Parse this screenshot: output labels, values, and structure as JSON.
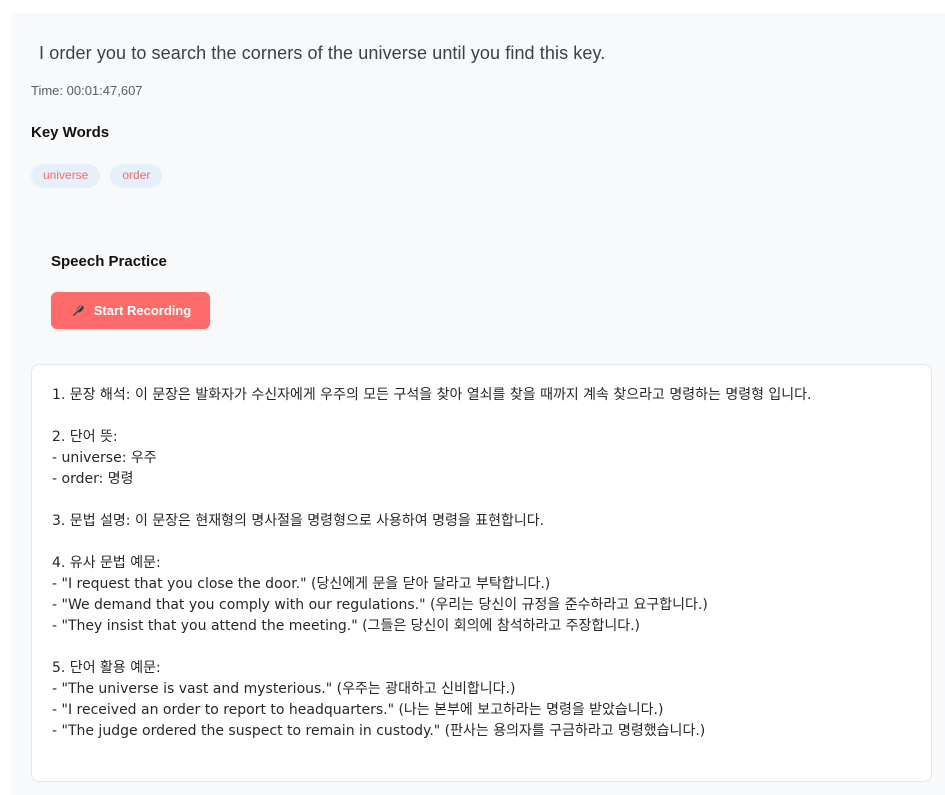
{
  "sentence": "I order you to search the corners of the universe until you find this key.",
  "time_text": "Time: 00:01:47,607",
  "keywords": {
    "title": "Key Words",
    "items": [
      "universe",
      "order"
    ]
  },
  "speech": {
    "title": "Speech Practice",
    "button_label": "Start Recording",
    "button_icon": "microphone-icon"
  },
  "analysis_text": "1. 문장 해석: 이 문장은 발화자가 수신자에게 우주의 모든 구석을 찾아 열쇠를 찾을 때까지 계속 찾으라고 명령하는 명령형 입니다.\n\n2. 단어 뜻:\n- universe: 우주\n- order: 명령\n\n3. 문법 설명: 이 문장은 현재형의 명사절을 명령형으로 사용하여 명령을 표현합니다.\n\n4. 유사 문법 예문:\n- \"I request that you close the door.\" (당신에게 문을 닫아 달라고 부탁합니다.)\n- \"We demand that you comply with our regulations.\" (우리는 당신이 규정을 준수하라고 요구합니다.)\n- \"They insist that you attend the meeting.\" (그들은 당신이 회의에 참석하라고 주장합니다.)\n\n5. 단어 활용 예문:\n- \"The universe is vast and mysterious.\" (우주는 광대하고 신비합니다.)\n- \"I received an order to report to headquarters.\" (나는 본부에 보고하라는 명령을 받았습니다.)\n- \"The judge ordered the suspect to remain in custody.\" (판사는 용의자를 구금하라고 명령했습니다.)",
  "colors": {
    "accent": "#ff6b6b",
    "tag_bg": "#e6f0fb",
    "tag_text": "#f06b6b"
  }
}
